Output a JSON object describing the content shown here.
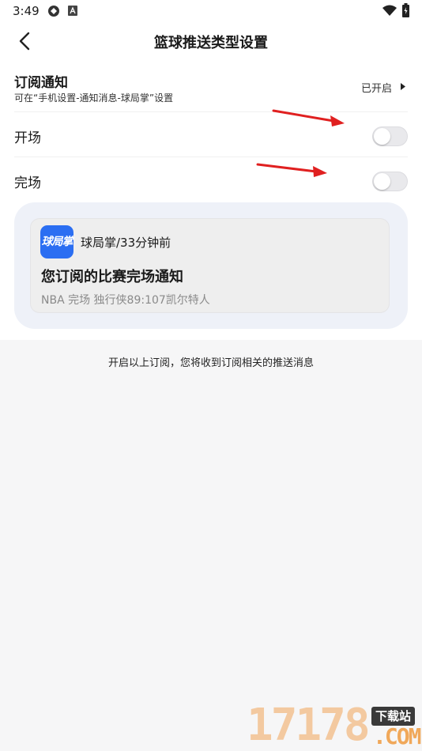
{
  "status_bar": {
    "time": "3:49",
    "icons": [
      "app-icon",
      "notification-a-icon",
      "wifi-icon",
      "battery-icon"
    ]
  },
  "header": {
    "title": "篮球推送类型设置",
    "back_icon": "chevron-left-icon"
  },
  "subscription": {
    "title": "订阅通知",
    "description": "可在“手机设置-通知消息-球局掌”设置",
    "status": "已开启"
  },
  "toggles": [
    {
      "label": "开场",
      "enabled": false
    },
    {
      "label": "完场",
      "enabled": false
    }
  ],
  "preview": {
    "app_logo_text": "球局掌",
    "meta": "球局掌/33分钟前",
    "title": "您订阅的比赛完场通知",
    "body": "NBA 完场 独行侠89:107凯尔特人"
  },
  "footer_note": "开启以上订阅，您将收到订阅相关的推送消息",
  "watermark": {
    "number": "17178",
    "tag": "下载站",
    "domain": ".COM"
  },
  "colors": {
    "accent_blue": "#2b6ef2",
    "arrow_red": "#e02020",
    "toggle_off": "#e9e9ec",
    "background": "#f6f6f7"
  }
}
